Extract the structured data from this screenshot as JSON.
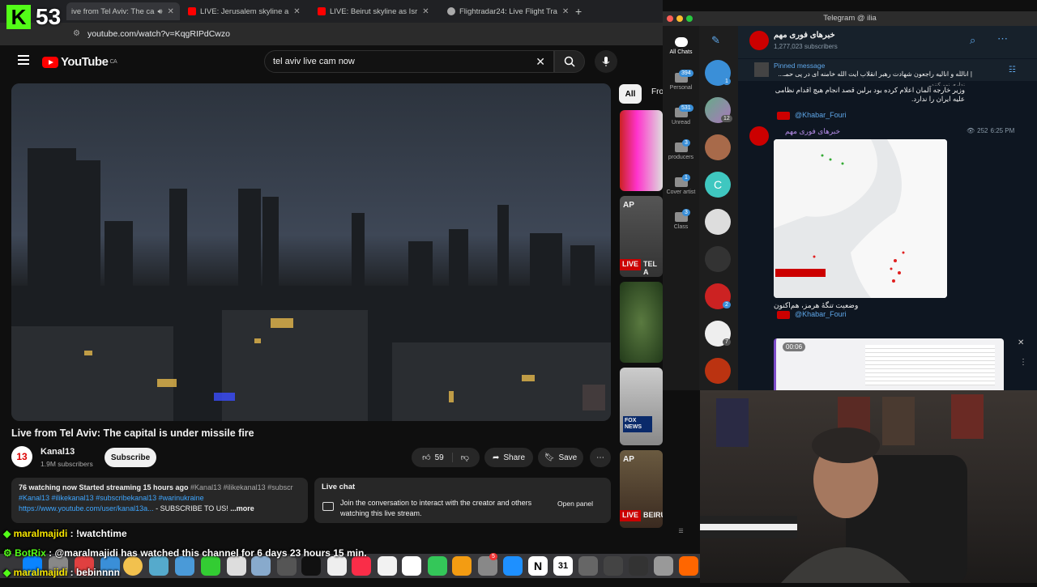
{
  "browser": {
    "tabs": [
      {
        "title": "ive from Tel Aviv: The ca"
      },
      {
        "title": "LIVE: Jerusalem skyline a"
      },
      {
        "title": "LIVE: Beirut skyline as Isr"
      },
      {
        "title": "Flightradar24: Live Flight Tra"
      }
    ],
    "url": "youtube.com/watch?v=KqgRIPdCwzo"
  },
  "kick_overlay": {
    "logo": "K",
    "number": "53"
  },
  "youtube": {
    "logo_text": "YouTube",
    "country": "CA",
    "search_value": "tel aviv live cam now",
    "video_title": "Live from Tel Aviv: The capital is under missile fire",
    "channel_name": "Kanal13",
    "channel_logo": "13",
    "subscribers": "1.9M subscribers",
    "subscribe_label": "Subscribe",
    "likes": "59",
    "share_label": "Share",
    "save_label": "Save",
    "desc_stats": "76 watching now  Started streaming 15 hours ago",
    "desc_tags_1": " #Kanal13 #ilikekanal13 #subscr",
    "desc_tags_2": "#Kanal13 #ilikekanal13 #subscribekanal13 #warinukraine",
    "desc_link": "https://www.youtube.com/user/kanal13a...",
    "desc_tail": " - SUBSCRIBE TO US! ",
    "desc_more": "...more",
    "live_chat_title": "Live chat",
    "live_chat_text": "Join the conversation to interact with the creator and others watching this live stream.",
    "open_panel": "Open panel",
    "filter_all": "All",
    "filter_from": "Fro",
    "side_labels": {
      "ap": "AP",
      "live": "LIVE",
      "tel_a": "TEL A",
      "beiru": "BEIRU",
      "fox": "FOX NEWS"
    }
  },
  "telegram": {
    "window_title": "Telegram @ ilia",
    "folders": [
      {
        "label": "All Chats",
        "badge": ""
      },
      {
        "label": "Personal",
        "badge": "394"
      },
      {
        "label": "Unread",
        "badge": "531"
      },
      {
        "label": "producers",
        "badge": "3"
      },
      {
        "label": "Cover artist",
        "badge": "1"
      },
      {
        "label": "Class",
        "badge": "3"
      }
    ],
    "channel_title": "خبرهای فوری مهم",
    "channel_subs": "1,277,023 subscribers",
    "pinned_label": "Pinned message",
    "pinned_text": "| اناللّه و انالیه راجعون شهادت رهبر انقلاب آیت الله خامنه ای در پی حمـ...",
    "msg1_line0": "نداری نمی‌کنند.",
    "msg1_line1": "وزیر خارجه آلمان اعلام کرده بود برلین قصد انجام هیچ اقدام نظامی",
    "msg1_line2": "علیه ایران را ندارد.",
    "handle": "@Khabar_Fouri",
    "msg2_sender": "خبرهای فوری مهم",
    "msg2_views": "252",
    "msg2_time": "6:25 PM",
    "map_caption": "وضعیت تنگهٔ هرمز، هم‌اکنون",
    "video_time": "00:06",
    "avatar_badges": [
      "1",
      "12",
      "2",
      "7"
    ],
    "avatar_c": "C"
  },
  "kick_chat": [
    {
      "user": "maralmajidi",
      "text": " : !watchtime"
    },
    {
      "user": "BotRix",
      "text": " : @maralmajidi has watched this channel for 6 days 23 hours 15 min."
    },
    {
      "user": "maralmajidi",
      "text": " : bebinnnn"
    }
  ],
  "dock": {
    "calendar": "31",
    "badge": "5"
  }
}
